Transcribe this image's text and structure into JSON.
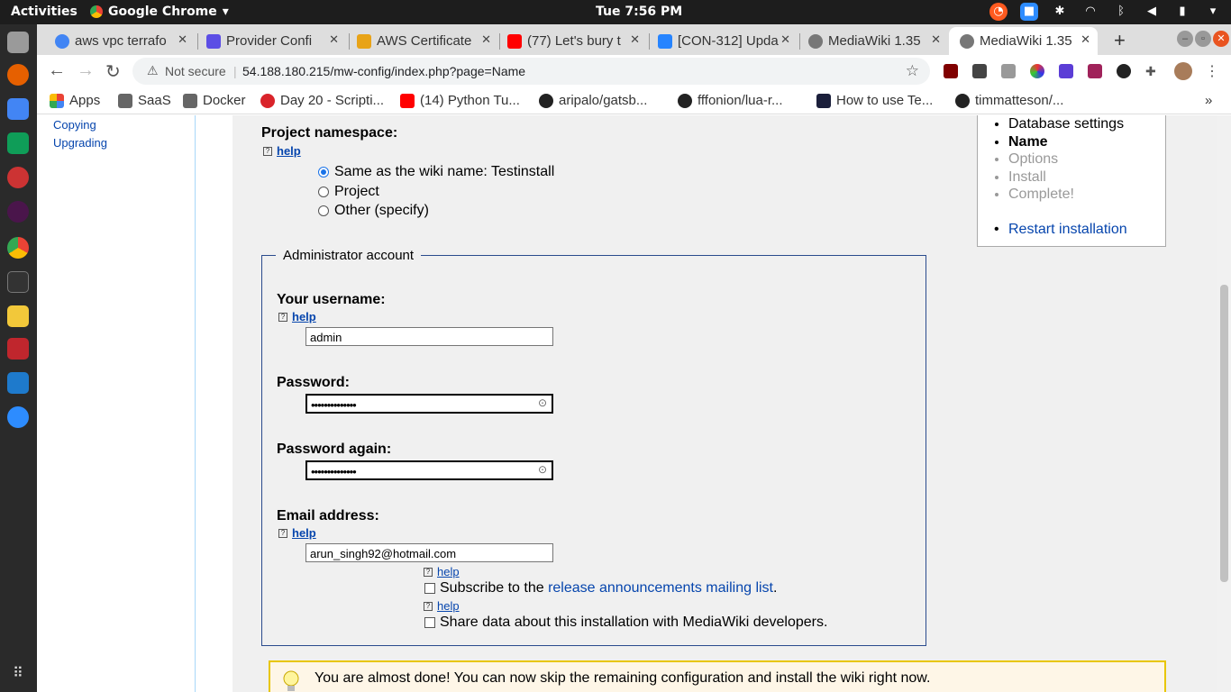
{
  "topbar": {
    "activities": "Activities",
    "app": "Google Chrome",
    "clock": "Tue  7:56 PM"
  },
  "tabs": [
    {
      "title": "aws vpc terrafo",
      "color": "#4285f4"
    },
    {
      "title": "Provider Confi",
      "color": "#5c4ee5"
    },
    {
      "title": "AWS Certificate",
      "color": "#e8a317"
    },
    {
      "title": "(77) Let's bury t",
      "color": "#ff0000"
    },
    {
      "title": "[CON-312] Upda",
      "color": "#2684ff"
    },
    {
      "title": "MediaWiki 1.35",
      "color": "#555555"
    },
    {
      "title": "MediaWiki 1.35",
      "color": "#555555"
    }
  ],
  "omnibox": {
    "not_secure": "Not secure",
    "url": "54.188.180.215/mw-config/index.php?page=Name"
  },
  "bookmarks": [
    "Apps",
    "SaaS",
    "Docker",
    "Day 20 - Scripti...",
    "(14) Python Tu...",
    "aripalo/gatsb...",
    "fffonion/lua-r...",
    "How to use Te...",
    "timmatteson/..."
  ],
  "sidebar": {
    "copying": "Copying",
    "upgrading": "Upgrading"
  },
  "form": {
    "namespace_label": "Project namespace:",
    "help": "help",
    "ns_options": [
      "Same as the wiki name: Testinstall",
      "Project",
      "Other (specify)"
    ],
    "admin_legend": "Administrator account",
    "username_label": "Your username:",
    "username_value": "admin",
    "password_label": "Password:",
    "password_value": "••••••••••••••",
    "password_again_label": "Password again:",
    "password_again_value": "••••••••••••••",
    "email_label": "Email address:",
    "email_value": "arun_singh92@hotmail.com",
    "subscribe_prefix": "Subscribe to the ",
    "subscribe_link": "release announcements mailing list",
    "subscribe_suffix": ".",
    "share_label": "Share data about this installation with MediaWiki developers."
  },
  "steps": {
    "items": [
      "Database settings",
      "Name",
      "Options",
      "Install",
      "Complete!"
    ],
    "restart": "Restart installation"
  },
  "notice": "You are almost done! You can now skip the remaining configuration and install the wiki right now."
}
